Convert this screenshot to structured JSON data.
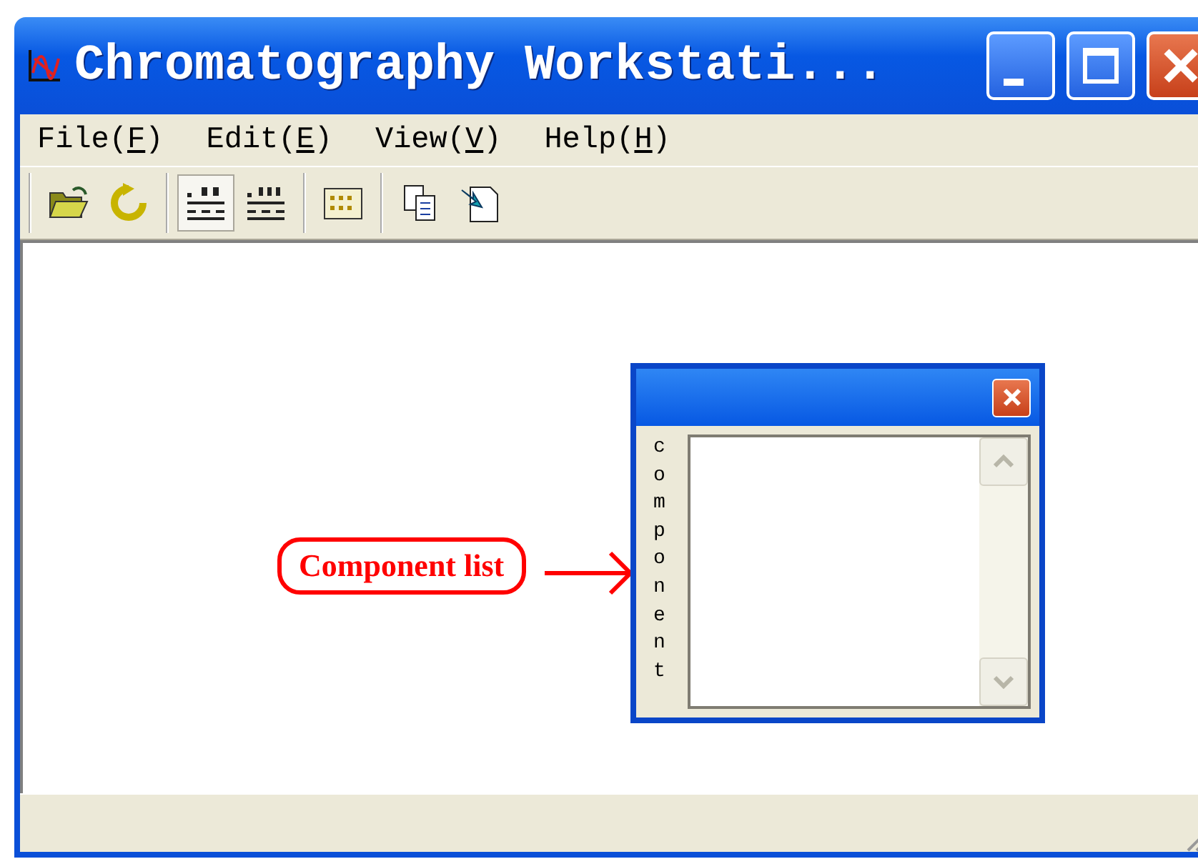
{
  "window": {
    "title": "Chromatography Workstati..."
  },
  "menu": [
    {
      "label": "File(F)"
    },
    {
      "label": "Edit(E)"
    },
    {
      "label": "View(V)"
    },
    {
      "label": "Help(H)"
    }
  ],
  "toolbar": [
    [
      {
        "selected": false
      },
      {
        "selected": false
      }
    ],
    [
      {
        "selected": true
      },
      {
        "selected": false
      }
    ],
    [
      {
        "selected": false
      }
    ],
    [
      {
        "selected": false
      },
      {
        "selected": false
      }
    ]
  ],
  "panel": {
    "side_label": "component"
  },
  "callout": {
    "text": "Component list"
  }
}
